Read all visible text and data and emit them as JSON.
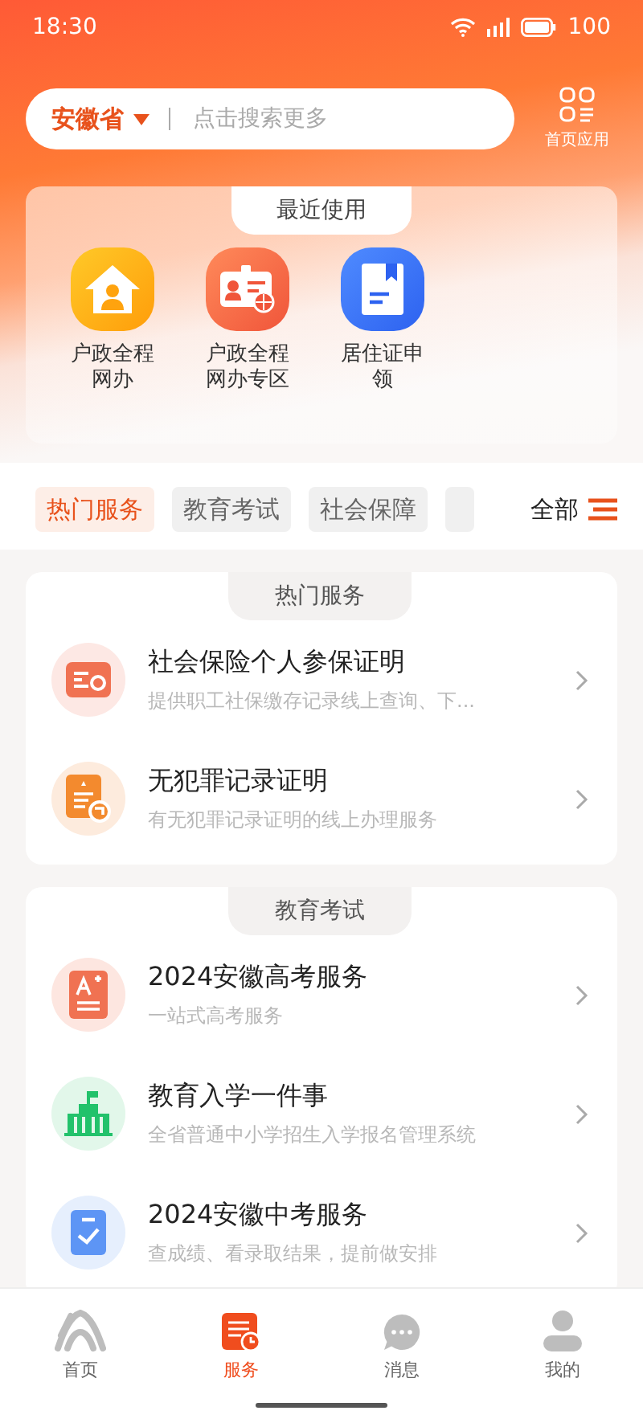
{
  "status_bar": {
    "time": "18:30",
    "battery": "100"
  },
  "search": {
    "region": "安徽省",
    "placeholder": "点击搜索更多",
    "apps_label": "首页应用"
  },
  "recent": {
    "title": "最近使用",
    "items": [
      {
        "kind": "house",
        "label": "户政全程网办"
      },
      {
        "kind": "idcard",
        "label": "户政全程网办专区"
      },
      {
        "kind": "book",
        "label": "居住证申领"
      }
    ]
  },
  "categories": {
    "items": [
      {
        "label": "热门服务",
        "selected": true
      },
      {
        "label": "教育考试",
        "selected": false
      },
      {
        "label": "社会保障",
        "selected": false
      },
      {
        "selected": false
      }
    ],
    "all_label": "全部"
  },
  "sections": [
    {
      "title": "热门服务",
      "items": [
        {
          "kind": "card",
          "title": "社会保险个人参保证明",
          "subtitle": "提供职工社保缴存记录线上查询、下..."
        },
        {
          "kind": "certificate",
          "title": "无犯罪记录证明",
          "subtitle": "有无犯罪记录证明的线上办理服务"
        }
      ]
    },
    {
      "title": "教育考试",
      "items": [
        {
          "kind": "grade",
          "title": "2024安徽高考服务",
          "subtitle": "一站式高考服务"
        },
        {
          "kind": "school",
          "title": "教育入学一件事",
          "subtitle": "全省普通中小学招生入学报名管理系统"
        },
        {
          "kind": "check",
          "title": "2024安徽中考服务",
          "subtitle": "查成绩、看录取结果，提前做安排"
        }
      ]
    }
  ],
  "tab_bar": [
    {
      "kind": "home",
      "label": "首页",
      "selected": false
    },
    {
      "kind": "service",
      "label": "服务",
      "selected": true
    },
    {
      "kind": "message",
      "label": "消息",
      "selected": false
    },
    {
      "kind": "me",
      "label": "我的",
      "selected": false
    }
  ]
}
